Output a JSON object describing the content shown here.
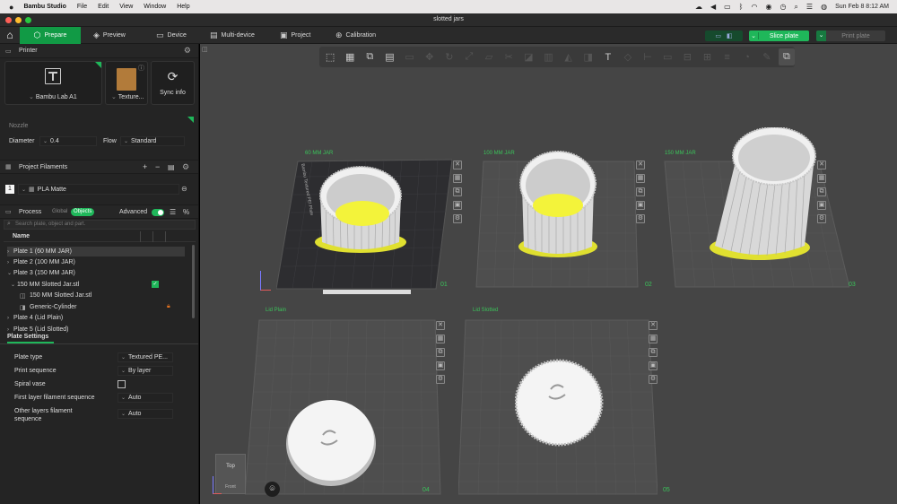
{
  "menubar": {
    "app_name": "Bambu Studio",
    "menus": [
      "File",
      "Edit",
      "View",
      "Window",
      "Help"
    ],
    "clock": "Sun Feb 8  8:12 AM"
  },
  "window": {
    "title": "slotted jars"
  },
  "tabs": [
    {
      "label": "Prepare"
    },
    {
      "label": "Preview"
    },
    {
      "label": "Device"
    },
    {
      "label": "Multi-device"
    },
    {
      "label": "Project"
    },
    {
      "label": "Calibration"
    }
  ],
  "topbar": {
    "slice_label": "Slice plate",
    "print_label": "Print plate"
  },
  "printer": {
    "section_title": "Printer",
    "name": "Bambu Lab A1",
    "plate": "Texture...",
    "sync_label": "Sync info",
    "nozzle_title": "Nozzle",
    "diameter_label": "Diameter",
    "diameter_value": "0.4",
    "flow_label": "Flow",
    "flow_value": "Standard"
  },
  "filaments": {
    "section_title": "Project Filaments",
    "items": [
      {
        "index": "1",
        "name": "PLA Matte"
      }
    ]
  },
  "process": {
    "section_title": "Process",
    "toggle_global": "Global",
    "toggle_objects": "Objects",
    "advanced_label": "Advanced",
    "search_placeholder": "Search plate, object and part.",
    "name_header": "Name"
  },
  "tree": [
    {
      "label": "Plate 1 (60 MM JAR)",
      "arrow": "›"
    },
    {
      "label": "Plate 2 (100 MM JAR)",
      "arrow": "›"
    },
    {
      "label": "Plate 3 (150 MM JAR)",
      "arrow": "⌄"
    },
    {
      "label": "150 MM Slotted Jar.stl",
      "arrow": "⌄"
    },
    {
      "label": "150 MM Slotted Jar.stl",
      "arrow": ""
    },
    {
      "label": "Generic-Cylinder",
      "arrow": ""
    },
    {
      "label": "Plate 4 (Lid Plain)",
      "arrow": "›"
    },
    {
      "label": "Plate 5 (Lid Slotted)",
      "arrow": "›"
    }
  ],
  "plate_settings": {
    "title": "Plate Settings",
    "rows": [
      {
        "label": "Plate type",
        "value": "Textured PE..."
      },
      {
        "label": "Print sequence",
        "value": "By layer"
      },
      {
        "label": "Spiral vase",
        "value": ""
      },
      {
        "label": "First layer filament sequence",
        "value": "Auto"
      },
      {
        "label": "Other layers filament sequence",
        "value": "Auto"
      }
    ]
  },
  "viewport": {
    "plates": [
      {
        "label": "60 MM JAR",
        "num": "01"
      },
      {
        "label": "100 MM JAR",
        "num": "02"
      },
      {
        "label": "150 MM JAR",
        "num": "03"
      },
      {
        "label": "Lid Plain",
        "num": "04"
      },
      {
        "label": "Lid Slotted",
        "num": "05"
      }
    ],
    "bed_text": "Bambu Textured PEI Plate",
    "viewcube_top": "Top",
    "viewcube_front": "Front"
  },
  "colors": {
    "accent": "#119a45",
    "slice": "#1fb75a",
    "filament": "#e8e84a",
    "plate_label": "#3bc35a",
    "viewport": "#454545"
  }
}
